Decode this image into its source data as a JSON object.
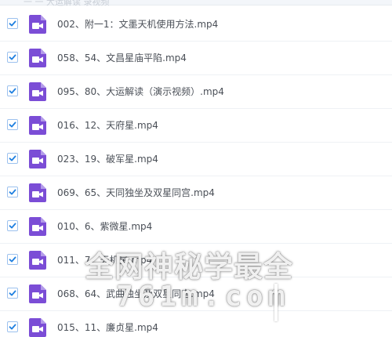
{
  "colors": {
    "accent": "#1e7fe0",
    "video_icon": "#7b4dd6",
    "text": "#4a4f57"
  },
  "header": {
    "partial_text": "一 一 大运解读 录视频"
  },
  "files": [
    {
      "name": "002、附一1：文墨天机使用方法.mp4",
      "checked": true,
      "icon": "video-file-icon"
    },
    {
      "name": "058、54、文昌星庙平陷.mp4",
      "checked": true,
      "icon": "video-file-icon"
    },
    {
      "name": "095、80、大运解读（演示视频）.mp4",
      "checked": true,
      "icon": "video-file-icon"
    },
    {
      "name": "016、12、天府星.mp4",
      "checked": true,
      "icon": "video-file-icon"
    },
    {
      "name": "023、19、破军星.mp4",
      "checked": true,
      "icon": "video-file-icon"
    },
    {
      "name": "069、65、天同独坐及双星同宫.mp4",
      "checked": true,
      "icon": "video-file-icon"
    },
    {
      "name": "010、6、紫微星.mp4",
      "checked": true,
      "icon": "video-file-icon"
    },
    {
      "name": "011、7、天机星.mp4",
      "checked": true,
      "icon": "video-file-icon"
    },
    {
      "name": "068、64、武曲独坐及双星同宫.mp4",
      "checked": true,
      "icon": "video-file-icon"
    },
    {
      "name": "015、11、廉贞星.mp4",
      "checked": true,
      "icon": "video-file-icon"
    }
  ],
  "watermark": {
    "line1": "全网神秘学最全",
    "line2": "761m.com"
  }
}
